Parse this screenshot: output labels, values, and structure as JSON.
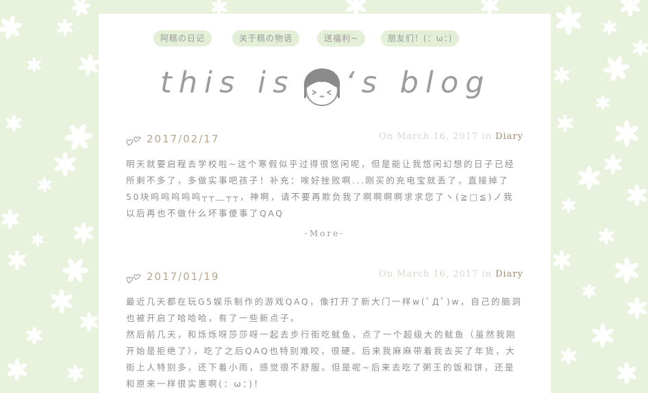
{
  "nav": {
    "items": [
      {
        "label": "阿糕の日记"
      },
      {
        "label": "关于糕の物语"
      },
      {
        "label": "送福利~"
      },
      {
        "label": "朋友们！(：ω：)"
      }
    ]
  },
  "header": {
    "title_before": "this is",
    "title_after": "‘s blog",
    "avatar_icon": "girl-face-icon"
  },
  "posts": [
    {
      "date": "2017/02/17",
      "meta_prefix": "On March 16, 2017 in",
      "category": "Diary",
      "paragraphs": [
        "明天就要启程去学校啦~这个寒假似乎过得很悠闲呢，但是能让我悠闲幻想的日子已经所剩不多了，多做实事吧孩子！补充：唉好挫败啊...刚买的充电宝就丢了，直接掉了50块呜呜呜呜呜┬┬﹏┬┬，神啊，请不要再欺负我了啊啊啊啊求求您了ヽ(≧□≦)ノ我以后再也不做什么坏事傻事了QAQ"
      ],
      "more_label": "-More-"
    },
    {
      "date": "2017/01/19",
      "meta_prefix": "On March 16, 2017 in",
      "category": "Diary",
      "paragraphs": [
        "最近几天都在玩G5娱乐制作的游戏QAQ，像打开了新大门一样w(ﾟДﾟ)w，自己的脑洞也被开启了哈哈哈，有了一些新点子。",
        "然后前几天，和烁烁呀莎莎呀一起去步行街吃鱿鱼，点了一个超级大的鱿鱼（虽然我刚开始是拒绝了），吃了之后QAQ也特别难咬，很硬。后来我麻麻带着我去买了年货，大街上人特别多，还下着小雨，感觉很不舒服。但是呢~后来去吃了粥王的饭和饼，还是和原来一样很实惠啊(：ω：)！"
      ]
    }
  ],
  "colors": {
    "background": "#e8f2dc",
    "flower": "#ffffff",
    "nav_pill": "#e3efd6",
    "date": "#b7a68c",
    "category": "#a08b6d",
    "body_text": "#8e8e8e"
  }
}
